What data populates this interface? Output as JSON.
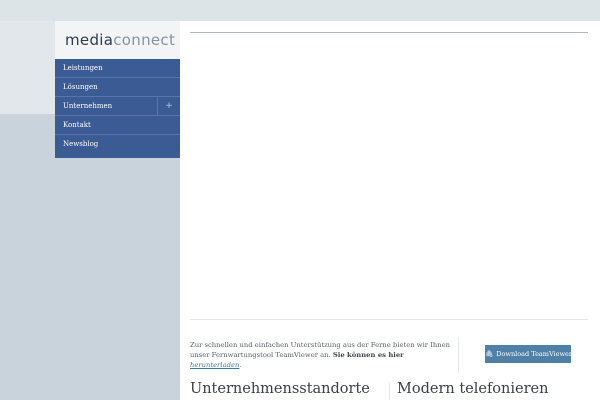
{
  "logo": {
    "part1": "media",
    "part2": "connect"
  },
  "nav": {
    "items": [
      {
        "label": "Leistungen"
      },
      {
        "label": "Lösungen"
      },
      {
        "label": "Unternehmen",
        "expand": "+"
      },
      {
        "label": "Kontakt"
      },
      {
        "label": "Newsblog"
      }
    ]
  },
  "support": {
    "text_before": "Zur schnellen und einfachen Unterstützung aus der Ferne bieten wir Ihnen unser Fernwartungstool TeamViewer an. ",
    "text_bold": "Sie können es hier ",
    "link": "herunterladen",
    "text_after": "."
  },
  "download_button": {
    "label": "Download TeamViewer",
    "icon": "paperclip-icon"
  },
  "headings": {
    "left": "Unternehmensstandorte",
    "right": "Modern telefonieren"
  },
  "colors": {
    "nav_bg": "#3b5b95",
    "button_bg": "#4f81a8",
    "page_bg": "#c9d3dc"
  }
}
